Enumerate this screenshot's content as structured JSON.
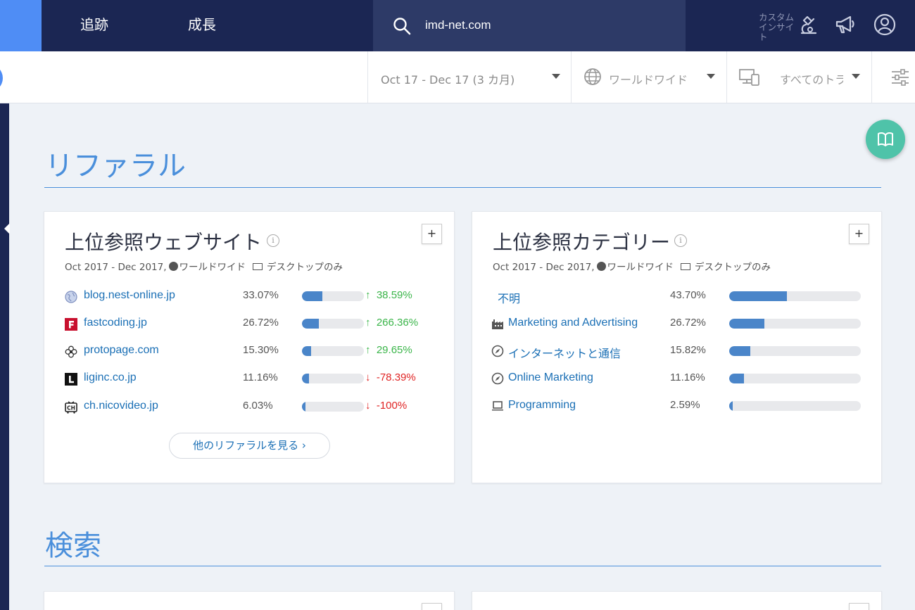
{
  "topbar": {
    "tabs": [
      {
        "label": "追跡"
      },
      {
        "label": "成長"
      }
    ],
    "search": {
      "value": "imd-net.com",
      "placeholder": ""
    },
    "custom_insight": "カスタムインサイト"
  },
  "filters": {
    "date_range": "Oct 17 - Dec 17 (3 カ月)",
    "region": "ワールドワイド",
    "traffic": "すべてのトラ"
  },
  "sections": {
    "referral_title": "リファラル",
    "search_title": "検索"
  },
  "top_sites": {
    "title": "上位参照ウェブサイト",
    "meta_period": "Oct 2017 - Dec 2017,",
    "meta_region": "ワールドワイド",
    "meta_device": "デスクトップのみ",
    "rows": [
      {
        "domain": "blog.nest-online.jp",
        "share": "33.07%",
        "share_value": 0.3307,
        "change": "38.59%",
        "dir": "up",
        "icon": "globe-favicon"
      },
      {
        "domain": "fastcoding.jp",
        "share": "26.72%",
        "share_value": 0.2672,
        "change": "266.36%",
        "dir": "up",
        "icon": "f-favicon"
      },
      {
        "domain": "protopage.com",
        "share": "15.30%",
        "share_value": 0.153,
        "change": "29.65%",
        "dir": "up",
        "icon": "flower-favicon"
      },
      {
        "domain": "liginc.co.jp",
        "share": "11.16%",
        "share_value": 0.1116,
        "change": "-78.39%",
        "dir": "down",
        "icon": "l-favicon"
      },
      {
        "domain": "ch.nicovideo.jp",
        "share": "6.03%",
        "share_value": 0.0603,
        "change": "-100%",
        "dir": "down",
        "icon": "ch-favicon"
      }
    ],
    "more_label": "他のリファラルを見る"
  },
  "top_categories": {
    "title": "上位参照カテゴリー",
    "meta_period": "Oct 2017 - Dec 2017,",
    "meta_region": "ワールドワイド",
    "meta_device": "デスクトップのみ",
    "rows": [
      {
        "name": "不明",
        "share": "43.70%",
        "share_value": 0.437,
        "icon": ""
      },
      {
        "name": "Marketing and Advertising",
        "share": "26.72%",
        "share_value": 0.2672,
        "icon": "factory-icon"
      },
      {
        "name": "インターネットと通信",
        "share": "15.82%",
        "share_value": 0.1582,
        "icon": "compass-icon"
      },
      {
        "name": "Online Marketing",
        "share": "11.16%",
        "share_value": 0.1116,
        "icon": "compass-icon"
      },
      {
        "name": "Programming",
        "share": "2.59%",
        "share_value": 0.0259,
        "icon": "laptop-icon"
      }
    ]
  },
  "colors": {
    "nav_bg": "#1b2653",
    "accent": "#4a8fdb",
    "bar_fill": "#4a85c9",
    "up": "#3bb54a",
    "down": "#e02424",
    "fab": "#4fc3a9"
  }
}
